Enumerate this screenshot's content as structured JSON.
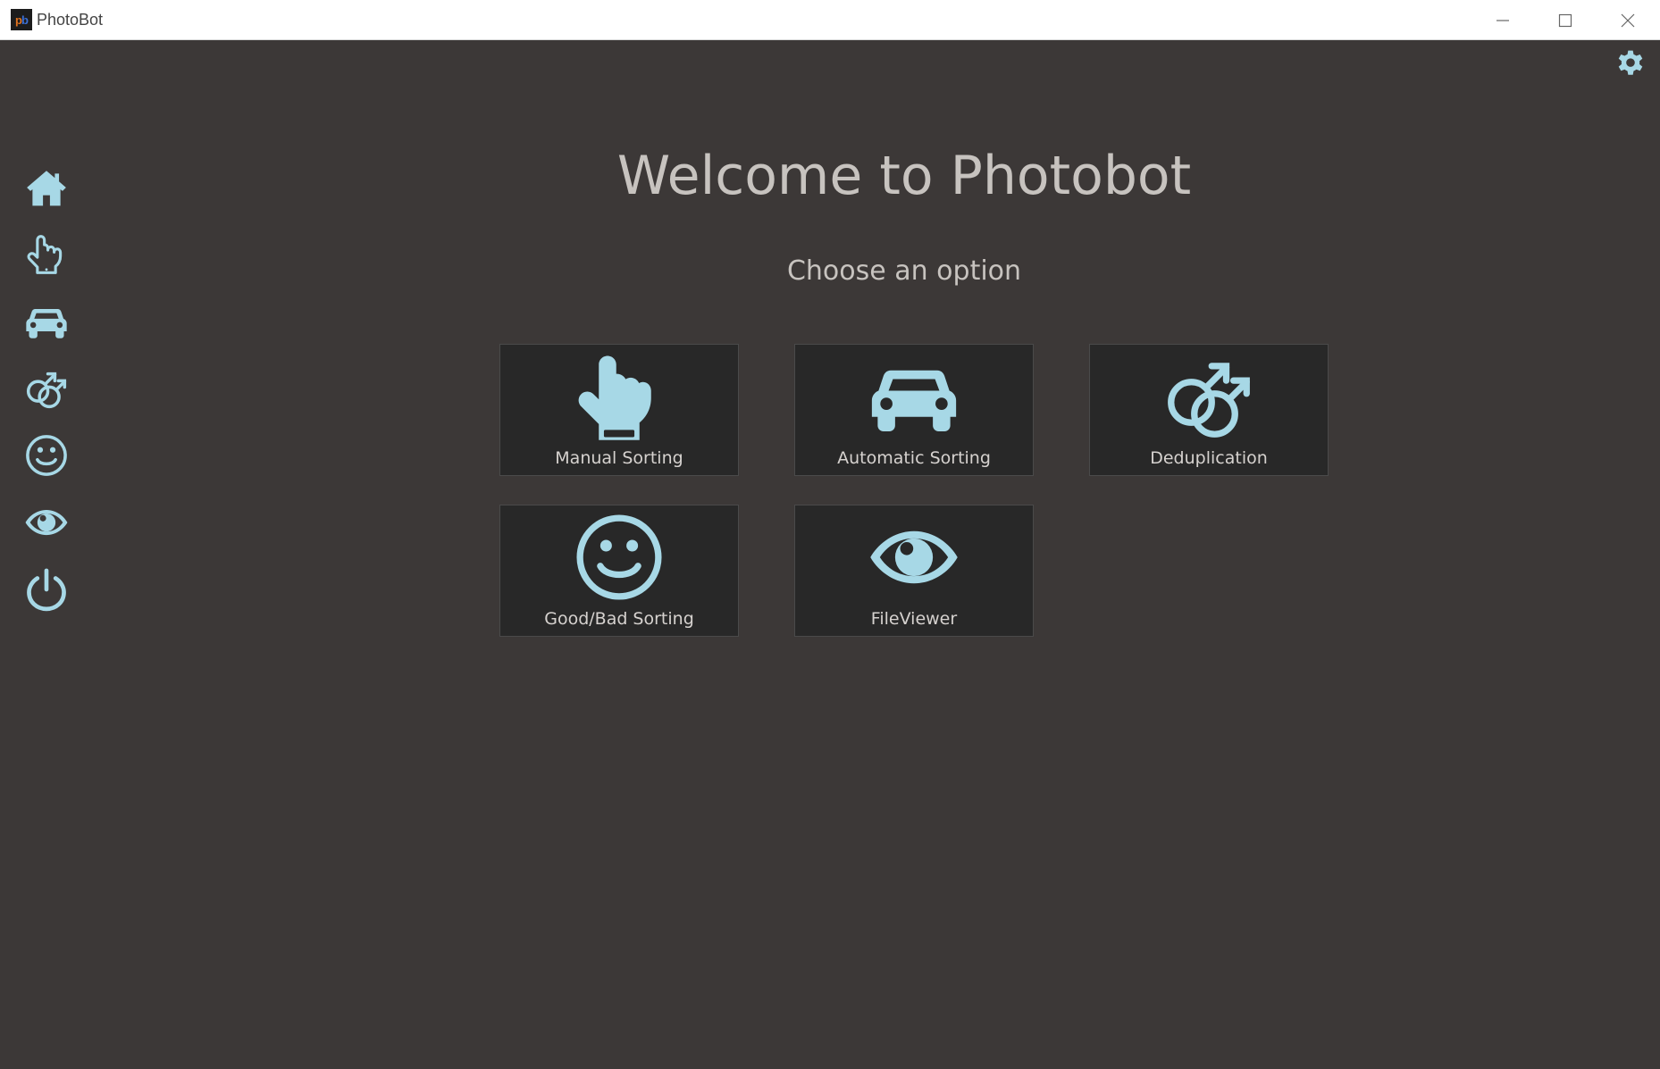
{
  "window": {
    "title": "PhotoBot",
    "logo_text_p": "p",
    "logo_text_b": "b"
  },
  "colors": {
    "background": "#3c3837",
    "tile_background": "#282828",
    "icon": "#a7d8e6",
    "text": "#c7c3bf"
  },
  "header": {
    "title": "Welcome to Photobot",
    "subtitle": "Choose an option"
  },
  "sidebar": {
    "items": [
      {
        "name": "home",
        "icon": "home-icon"
      },
      {
        "name": "manual-sorting",
        "icon": "pointing-hand-icon"
      },
      {
        "name": "automatic-sorting",
        "icon": "car-icon"
      },
      {
        "name": "deduplication",
        "icon": "double-mars-icon"
      },
      {
        "name": "good-bad-sorting",
        "icon": "smiley-icon"
      },
      {
        "name": "fileviewer",
        "icon": "eye-icon"
      },
      {
        "name": "power",
        "icon": "power-icon"
      }
    ]
  },
  "tiles": [
    {
      "label": "Manual Sorting",
      "icon": "pointing-hand-icon"
    },
    {
      "label": "Automatic Sorting",
      "icon": "car-icon"
    },
    {
      "label": "Deduplication",
      "icon": "double-mars-icon"
    },
    {
      "label": "Good/Bad Sorting",
      "icon": "smiley-icon"
    },
    {
      "label": "FileViewer",
      "icon": "eye-icon"
    }
  ]
}
